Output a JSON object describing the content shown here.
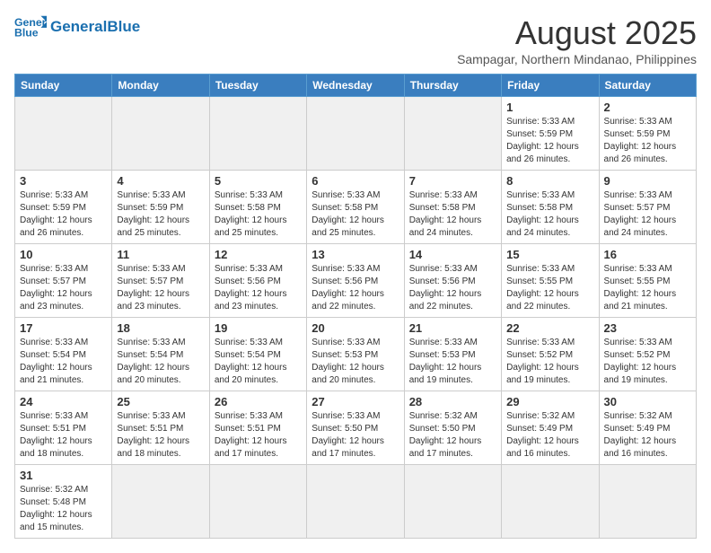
{
  "header": {
    "logo_general": "General",
    "logo_blue": "Blue",
    "month_title": "August 2025",
    "location": "Sampagar, Northern Mindanao, Philippines"
  },
  "weekdays": [
    "Sunday",
    "Monday",
    "Tuesday",
    "Wednesday",
    "Thursday",
    "Friday",
    "Saturday"
  ],
  "weeks": [
    [
      {
        "day": "",
        "info": ""
      },
      {
        "day": "",
        "info": ""
      },
      {
        "day": "",
        "info": ""
      },
      {
        "day": "",
        "info": ""
      },
      {
        "day": "",
        "info": ""
      },
      {
        "day": "1",
        "info": "Sunrise: 5:33 AM\nSunset: 5:59 PM\nDaylight: 12 hours\nand 26 minutes."
      },
      {
        "day": "2",
        "info": "Sunrise: 5:33 AM\nSunset: 5:59 PM\nDaylight: 12 hours\nand 26 minutes."
      }
    ],
    [
      {
        "day": "3",
        "info": "Sunrise: 5:33 AM\nSunset: 5:59 PM\nDaylight: 12 hours\nand 26 minutes."
      },
      {
        "day": "4",
        "info": "Sunrise: 5:33 AM\nSunset: 5:59 PM\nDaylight: 12 hours\nand 25 minutes."
      },
      {
        "day": "5",
        "info": "Sunrise: 5:33 AM\nSunset: 5:58 PM\nDaylight: 12 hours\nand 25 minutes."
      },
      {
        "day": "6",
        "info": "Sunrise: 5:33 AM\nSunset: 5:58 PM\nDaylight: 12 hours\nand 25 minutes."
      },
      {
        "day": "7",
        "info": "Sunrise: 5:33 AM\nSunset: 5:58 PM\nDaylight: 12 hours\nand 24 minutes."
      },
      {
        "day": "8",
        "info": "Sunrise: 5:33 AM\nSunset: 5:58 PM\nDaylight: 12 hours\nand 24 minutes."
      },
      {
        "day": "9",
        "info": "Sunrise: 5:33 AM\nSunset: 5:57 PM\nDaylight: 12 hours\nand 24 minutes."
      }
    ],
    [
      {
        "day": "10",
        "info": "Sunrise: 5:33 AM\nSunset: 5:57 PM\nDaylight: 12 hours\nand 23 minutes."
      },
      {
        "day": "11",
        "info": "Sunrise: 5:33 AM\nSunset: 5:57 PM\nDaylight: 12 hours\nand 23 minutes."
      },
      {
        "day": "12",
        "info": "Sunrise: 5:33 AM\nSunset: 5:56 PM\nDaylight: 12 hours\nand 23 minutes."
      },
      {
        "day": "13",
        "info": "Sunrise: 5:33 AM\nSunset: 5:56 PM\nDaylight: 12 hours\nand 22 minutes."
      },
      {
        "day": "14",
        "info": "Sunrise: 5:33 AM\nSunset: 5:56 PM\nDaylight: 12 hours\nand 22 minutes."
      },
      {
        "day": "15",
        "info": "Sunrise: 5:33 AM\nSunset: 5:55 PM\nDaylight: 12 hours\nand 22 minutes."
      },
      {
        "day": "16",
        "info": "Sunrise: 5:33 AM\nSunset: 5:55 PM\nDaylight: 12 hours\nand 21 minutes."
      }
    ],
    [
      {
        "day": "17",
        "info": "Sunrise: 5:33 AM\nSunset: 5:54 PM\nDaylight: 12 hours\nand 21 minutes."
      },
      {
        "day": "18",
        "info": "Sunrise: 5:33 AM\nSunset: 5:54 PM\nDaylight: 12 hours\nand 20 minutes."
      },
      {
        "day": "19",
        "info": "Sunrise: 5:33 AM\nSunset: 5:54 PM\nDaylight: 12 hours\nand 20 minutes."
      },
      {
        "day": "20",
        "info": "Sunrise: 5:33 AM\nSunset: 5:53 PM\nDaylight: 12 hours\nand 20 minutes."
      },
      {
        "day": "21",
        "info": "Sunrise: 5:33 AM\nSunset: 5:53 PM\nDaylight: 12 hours\nand 19 minutes."
      },
      {
        "day": "22",
        "info": "Sunrise: 5:33 AM\nSunset: 5:52 PM\nDaylight: 12 hours\nand 19 minutes."
      },
      {
        "day": "23",
        "info": "Sunrise: 5:33 AM\nSunset: 5:52 PM\nDaylight: 12 hours\nand 19 minutes."
      }
    ],
    [
      {
        "day": "24",
        "info": "Sunrise: 5:33 AM\nSunset: 5:51 PM\nDaylight: 12 hours\nand 18 minutes."
      },
      {
        "day": "25",
        "info": "Sunrise: 5:33 AM\nSunset: 5:51 PM\nDaylight: 12 hours\nand 18 minutes."
      },
      {
        "day": "26",
        "info": "Sunrise: 5:33 AM\nSunset: 5:51 PM\nDaylight: 12 hours\nand 17 minutes."
      },
      {
        "day": "27",
        "info": "Sunrise: 5:33 AM\nSunset: 5:50 PM\nDaylight: 12 hours\nand 17 minutes."
      },
      {
        "day": "28",
        "info": "Sunrise: 5:32 AM\nSunset: 5:50 PM\nDaylight: 12 hours\nand 17 minutes."
      },
      {
        "day": "29",
        "info": "Sunrise: 5:32 AM\nSunset: 5:49 PM\nDaylight: 12 hours\nand 16 minutes."
      },
      {
        "day": "30",
        "info": "Sunrise: 5:32 AM\nSunset: 5:49 PM\nDaylight: 12 hours\nand 16 minutes."
      }
    ],
    [
      {
        "day": "31",
        "info": "Sunrise: 5:32 AM\nSunset: 5:48 PM\nDaylight: 12 hours\nand 15 minutes."
      },
      {
        "day": "",
        "info": ""
      },
      {
        "day": "",
        "info": ""
      },
      {
        "day": "",
        "info": ""
      },
      {
        "day": "",
        "info": ""
      },
      {
        "day": "",
        "info": ""
      },
      {
        "day": "",
        "info": ""
      }
    ]
  ]
}
